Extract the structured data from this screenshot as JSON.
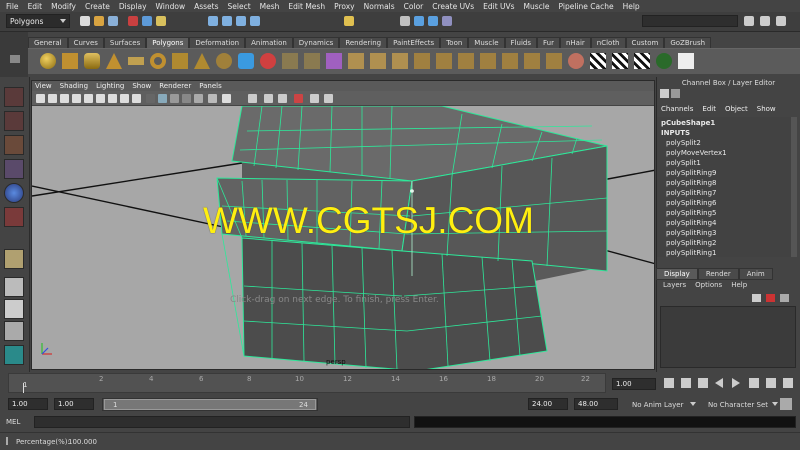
{
  "menubar": [
    "File",
    "Edit",
    "Modify",
    "Create",
    "Display",
    "Window",
    "Assets",
    "Select",
    "Mesh",
    "Edit Mesh",
    "Proxy",
    "Normals",
    "Color",
    "Create UVs",
    "Edit UVs",
    "Muscle",
    "Pipeline Cache",
    "Help"
  ],
  "mode_dropdown": "Polygons",
  "shelf_tabs": [
    "General",
    "Curves",
    "Surfaces",
    "Polygons",
    "Deformation",
    "Animation",
    "Dynamics",
    "Rendering",
    "PaintEffects",
    "Toon",
    "Muscle",
    "Fluids",
    "Fur",
    "nHair",
    "nCloth",
    "Custom",
    "GoZBrush"
  ],
  "active_shelf_tab": "Polygons",
  "viewport": {
    "menu": [
      "View",
      "Shading",
      "Lighting",
      "Show",
      "Renderer",
      "Panels"
    ],
    "camera_label": "persp",
    "help_line": "Click-drag on next edge. To finish, press Enter.",
    "watermark": "WWW.CGTSJ.COM",
    "accent_wire": "#2ee89a"
  },
  "channel_box": {
    "title": "Channel Box / Layer Editor",
    "menu": [
      "Channels",
      "Edit",
      "Object",
      "Show"
    ],
    "object": "pCubeShape1",
    "inputs_label": "INPUTS",
    "inputs": [
      "polySplit2",
      "polyMoveVertex1",
      "polySplit1",
      "polySplitRing9",
      "polySplitRing8",
      "polySplitRing7",
      "polySplitRing6",
      "polySplitRing5",
      "polySplitRing4",
      "polySplitRing3",
      "polySplitRing2",
      "polySplitRing1"
    ]
  },
  "layer_editor": {
    "tabs": [
      "Display",
      "Render",
      "Anim"
    ],
    "active_tab": "Display",
    "menu": [
      "Layers",
      "Options",
      "Help"
    ]
  },
  "timeline": {
    "ticks": [
      "2",
      "4",
      "6",
      "8",
      "10",
      "12",
      "14",
      "16",
      "18",
      "20",
      "22",
      "24"
    ],
    "start_label": "1",
    "current_frame": "1.00"
  },
  "range": {
    "start": "1.00",
    "start2": "1.00",
    "slider_start": "1",
    "slider_end": "24",
    "end": "24.00",
    "end2": "48.00",
    "anim_layer": "No Anim Layer",
    "character_set": "No Character Set"
  },
  "command_line": {
    "label": "MEL"
  },
  "help_status": {
    "label": "Percentage(%):",
    "value": "100.000"
  }
}
